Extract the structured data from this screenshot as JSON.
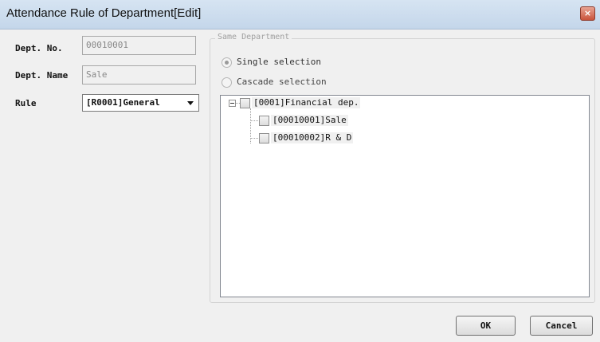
{
  "window": {
    "title": "Attendance Rule of Department[Edit]",
    "close_glyph": "×"
  },
  "form": {
    "dept_no_label": "Dept. No.",
    "dept_no_value": "00010001",
    "dept_name_label": "Dept. Name",
    "dept_name_value": "Sale",
    "rule_label": "Rule",
    "rule_value": "[R0001]General"
  },
  "same_department": {
    "legend": "Same Department",
    "options": [
      {
        "label": "Single selection",
        "selected": true
      },
      {
        "label": "Cascade selection",
        "selected": false
      }
    ],
    "tree": {
      "root": "[0001]Financial dep.",
      "children": [
        "[00010001]Sale",
        "[00010002]R & D"
      ]
    }
  },
  "buttons": {
    "ok": "OK",
    "cancel": "Cancel"
  }
}
